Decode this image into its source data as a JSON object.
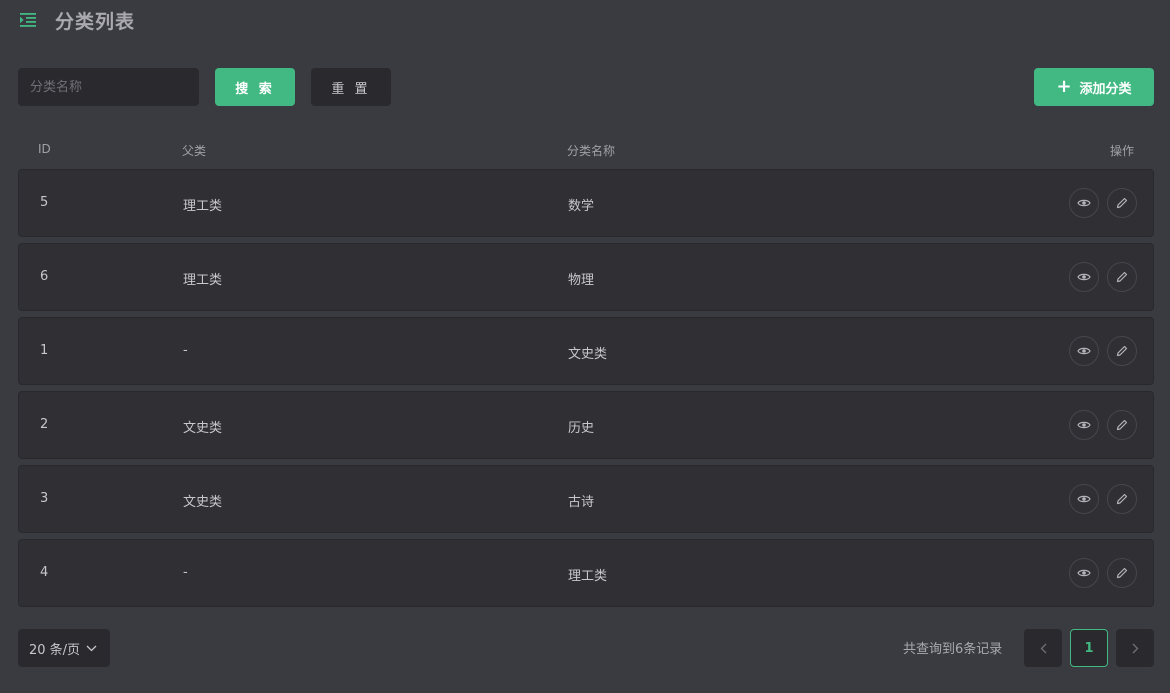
{
  "header": {
    "title": "分类列表",
    "menu_icon": "indent-menu-icon"
  },
  "toolbar": {
    "search_placeholder": "分类名称",
    "search_label": "搜 索",
    "reset_label": "重 置",
    "add_label": "添加分类"
  },
  "table": {
    "columns": {
      "id": "ID",
      "parent": "父类",
      "name": "分类名称",
      "ops": "操作"
    },
    "rows": [
      {
        "id": "5",
        "parent": "理工类",
        "name": "数学"
      },
      {
        "id": "6",
        "parent": "理工类",
        "name": "物理"
      },
      {
        "id": "1",
        "parent": "-",
        "name": "文史类"
      },
      {
        "id": "2",
        "parent": "文史类",
        "name": "历史"
      },
      {
        "id": "3",
        "parent": "文史类",
        "name": "古诗"
      },
      {
        "id": "4",
        "parent": "-",
        "name": "理工类"
      }
    ]
  },
  "pagination": {
    "page_size": "20 条/页",
    "total_text": "共查询到6条记录",
    "current_page": "1"
  },
  "colors": {
    "accent": "#42b983",
    "background": "#3a3a41",
    "row": "#2f2f34"
  }
}
